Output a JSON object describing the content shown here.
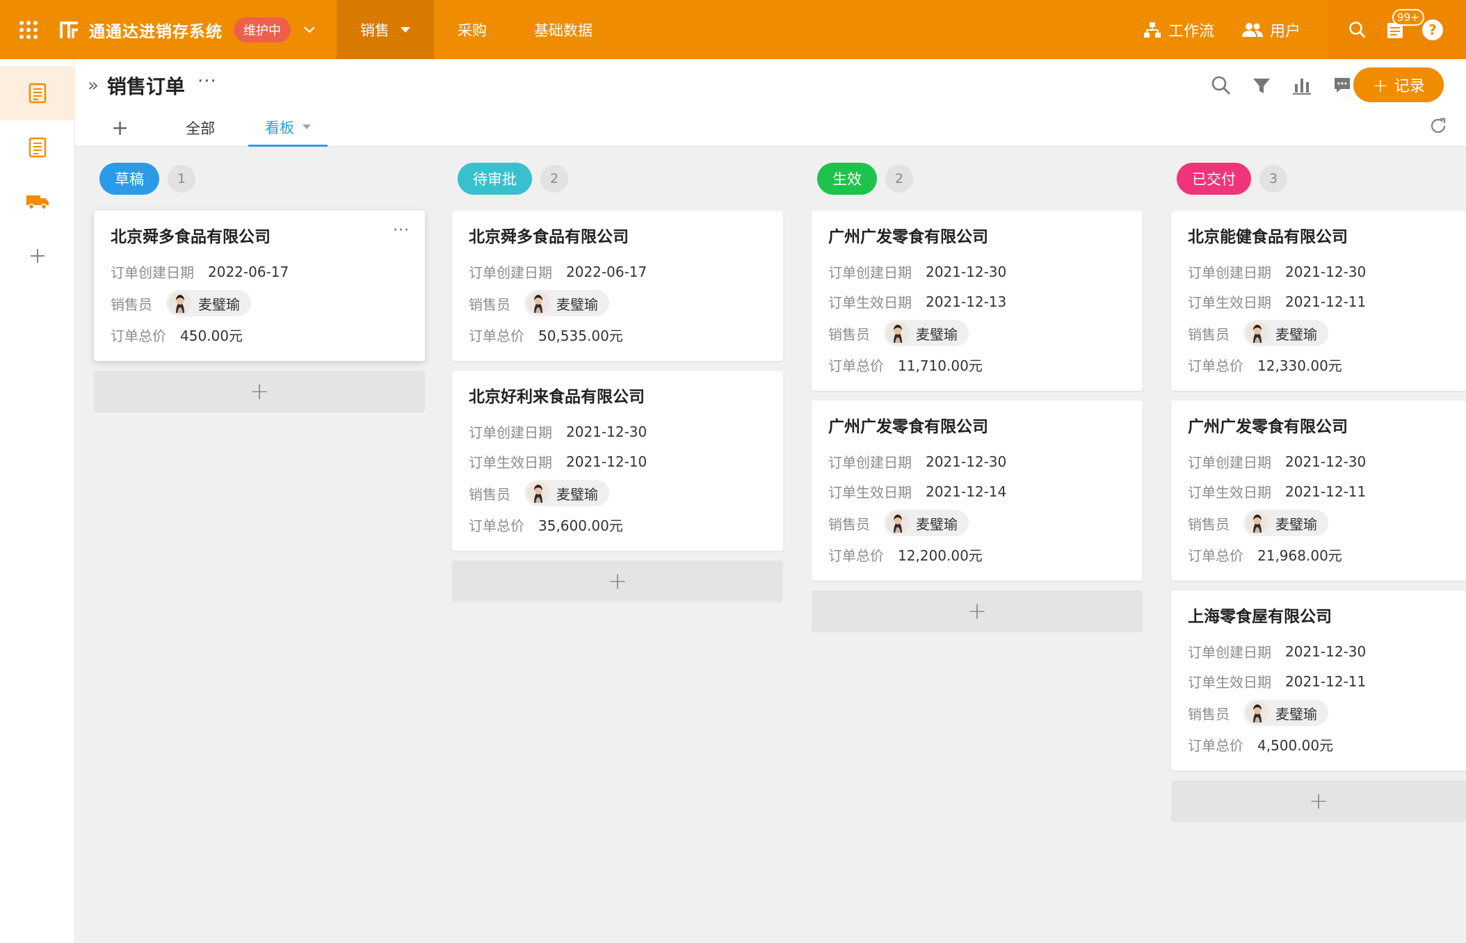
{
  "topbar": {
    "app_title": "通通达进销存系统",
    "status_badge": "维护中",
    "nav": [
      {
        "label": "销售",
        "active": true
      },
      {
        "label": "采购",
        "active": false
      },
      {
        "label": "基础数据",
        "active": false
      }
    ],
    "workflow_label": "工作流",
    "users_label": "用户",
    "notification_count": "99+",
    "help_label": "?",
    "accent_color": "#f08c00"
  },
  "sidebar": {
    "items": [
      {
        "icon": "document-list-icon",
        "active": true
      },
      {
        "icon": "document-list-icon",
        "active": false
      },
      {
        "icon": "truck-icon",
        "active": false
      },
      {
        "icon": "plus-icon",
        "active": false
      }
    ]
  },
  "header": {
    "page_title": "销售订单",
    "add_record_label": "记录",
    "tabs": [
      {
        "label": "全部",
        "active": false
      },
      {
        "label": "看板",
        "active": true
      }
    ]
  },
  "board": {
    "columns": [
      {
        "stage": "草稿",
        "count": "1",
        "color": "#2c9be7",
        "cards": [
          {
            "company": "北京舜多食品有限公司",
            "fields": [
              {
                "label": "订单创建日期",
                "value": "2022-06-17"
              },
              {
                "label": "销售员",
                "person": "麦璧瑜"
              },
              {
                "label": "订单总价",
                "value": "450.00元"
              }
            ]
          }
        ]
      },
      {
        "stage": "待审批",
        "count": "2",
        "color": "#37c1cf",
        "cards": [
          {
            "company": "北京舜多食品有限公司",
            "fields": [
              {
                "label": "订单创建日期",
                "value": "2022-06-17"
              },
              {
                "label": "销售员",
                "person": "麦璧瑜"
              },
              {
                "label": "订单总价",
                "value": "50,535.00元"
              }
            ]
          },
          {
            "company": "北京好利来食品有限公司",
            "fields": [
              {
                "label": "订单创建日期",
                "value": "2021-12-30"
              },
              {
                "label": "订单生效日期",
                "value": "2021-12-10"
              },
              {
                "label": "销售员",
                "person": "麦璧瑜"
              },
              {
                "label": "订单总价",
                "value": "35,600.00元"
              }
            ]
          }
        ]
      },
      {
        "stage": "生效",
        "count": "2",
        "color": "#1dc34b",
        "cards": [
          {
            "company": "广州广发零食有限公司",
            "fields": [
              {
                "label": "订单创建日期",
                "value": "2021-12-30"
              },
              {
                "label": "订单生效日期",
                "value": "2021-12-13"
              },
              {
                "label": "销售员",
                "person": "麦璧瑜"
              },
              {
                "label": "订单总价",
                "value": "11,710.00元"
              }
            ]
          },
          {
            "company": "广州广发零食有限公司",
            "fields": [
              {
                "label": "订单创建日期",
                "value": "2021-12-30"
              },
              {
                "label": "订单生效日期",
                "value": "2021-12-14"
              },
              {
                "label": "销售员",
                "person": "麦璧瑜"
              },
              {
                "label": "订单总价",
                "value": "12,200.00元"
              }
            ]
          }
        ]
      },
      {
        "stage": "已交付",
        "count": "3",
        "color": "#f0347a",
        "cards": [
          {
            "company": "北京能健食品有限公司",
            "fields": [
              {
                "label": "订单创建日期",
                "value": "2021-12-30"
              },
              {
                "label": "订单生效日期",
                "value": "2021-12-11"
              },
              {
                "label": "销售员",
                "person": "麦璧瑜"
              },
              {
                "label": "订单总价",
                "value": "12,330.00元"
              }
            ]
          },
          {
            "company": "广州广发零食有限公司",
            "fields": [
              {
                "label": "订单创建日期",
                "value": "2021-12-30"
              },
              {
                "label": "订单生效日期",
                "value": "2021-12-11"
              },
              {
                "label": "销售员",
                "person": "麦璧瑜"
              },
              {
                "label": "订单总价",
                "value": "21,968.00元"
              }
            ]
          },
          {
            "company": "上海零食屋有限公司",
            "fields": [
              {
                "label": "订单创建日期",
                "value": "2021-12-30"
              },
              {
                "label": "订单生效日期",
                "value": "2021-12-11"
              },
              {
                "label": "销售员",
                "person": "麦璧瑜"
              },
              {
                "label": "订单总价",
                "value": "4,500.00元"
              }
            ]
          }
        ]
      }
    ]
  }
}
